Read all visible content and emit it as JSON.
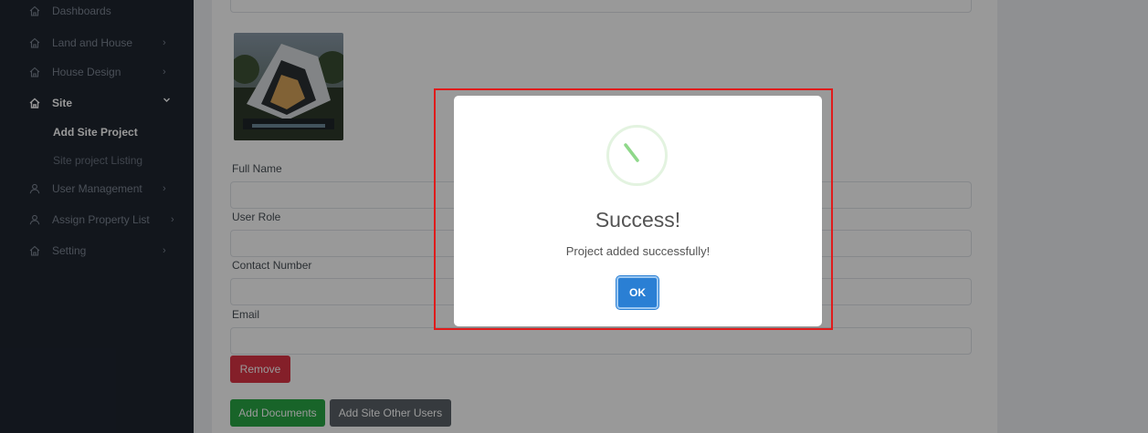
{
  "sidebar": {
    "items": [
      {
        "label": "Dashboards",
        "icon": "home-icon"
      },
      {
        "label": "Land and House",
        "icon": "home-icon",
        "chevron": "›"
      },
      {
        "label": "House Design",
        "icon": "home-icon",
        "chevron": "›"
      },
      {
        "label": "Site",
        "icon": "home-icon",
        "chevron": "⌄"
      },
      {
        "label": "User Management",
        "icon": "user-icon",
        "chevron": "›"
      },
      {
        "label": "Assign Property List",
        "icon": "user-icon",
        "chevron": "›"
      },
      {
        "label": "Setting",
        "icon": "home-icon",
        "chevron": "›"
      }
    ],
    "site_subitems": [
      {
        "label": "Add Site Project"
      },
      {
        "label": "Site project Listing"
      }
    ]
  },
  "form": {
    "fields": [
      {
        "label": "Full Name"
      },
      {
        "label": "User Role"
      },
      {
        "label": "Contact Number"
      },
      {
        "label": "Email"
      }
    ],
    "remove_label": "Remove",
    "add_documents_label": "Add Documents",
    "add_other_users_label": "Add Site Other Users"
  },
  "modal": {
    "title": "Success!",
    "message": "Project added successfully!",
    "ok_label": "OK"
  },
  "colors": {
    "sidebar_bg": "#1e2530",
    "remove": "#dc3545",
    "add_documents": "#28a745",
    "add_other_users": "#5a6268",
    "ok": "#2a7fd4",
    "success_icon": "#8fd88a",
    "highlight": "#e01b1b"
  }
}
